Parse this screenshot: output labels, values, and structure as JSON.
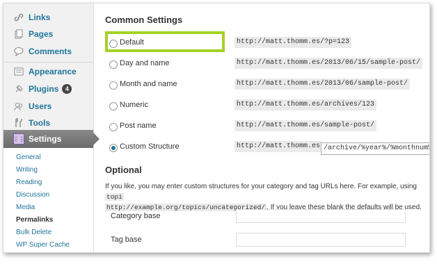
{
  "sidebar": {
    "items": [
      {
        "label": "Links",
        "icon": "link-icon"
      },
      {
        "label": "Pages",
        "icon": "pages-icon"
      },
      {
        "label": "Comments",
        "icon": "comments-icon"
      },
      {
        "label": "Appearance",
        "icon": "appearance-icon"
      },
      {
        "label": "Plugins",
        "icon": "plugins-icon",
        "badge": "4"
      },
      {
        "label": "Users",
        "icon": "users-icon"
      },
      {
        "label": "Tools",
        "icon": "tools-icon"
      }
    ],
    "active": {
      "label": "Settings",
      "icon": "settings-icon"
    },
    "submenu": [
      "General",
      "Writing",
      "Reading",
      "Discussion",
      "Media",
      "Permalinks",
      "Bulk Delete",
      "WP Super Cache"
    ],
    "submenu_current": "Permalinks"
  },
  "common": {
    "heading": "Common Settings",
    "options": [
      {
        "label": "Default",
        "example": "http://matt.thomm.es/?p=123",
        "checked": false
      },
      {
        "label": "Day and name",
        "example": "http://matt.thomm.es/2013/06/15/sample-post/",
        "checked": false
      },
      {
        "label": "Month and name",
        "example": "http://matt.thomm.es/2013/06/sample-post/",
        "checked": false
      },
      {
        "label": "Numeric",
        "example": "http://matt.thomm.es/archives/123",
        "checked": false
      },
      {
        "label": "Post name",
        "example": "http://matt.thomm.es/sample-post/",
        "checked": false
      },
      {
        "label": "Custom Structure",
        "example": "http://matt.thomm.es",
        "checked": true
      }
    ],
    "custom_value": "/archive/%year%/%monthnum%/",
    "highlight_color": "#a4d227"
  },
  "optional": {
    "heading": "Optional",
    "desc_before": "If you like, you may enter custom structures for your category and tag URLs here. For example, using ",
    "desc_code1": "topi",
    "desc_code2": "http://example.org/topics/uncategorized/",
    "desc_after": ". If you leave these blank the defaults will be used.",
    "category_label": "Category base",
    "category_value": "",
    "tag_label": "Tag base",
    "tag_value": ""
  },
  "colors": {
    "link": "#21759b",
    "active_menu": "#777777"
  }
}
